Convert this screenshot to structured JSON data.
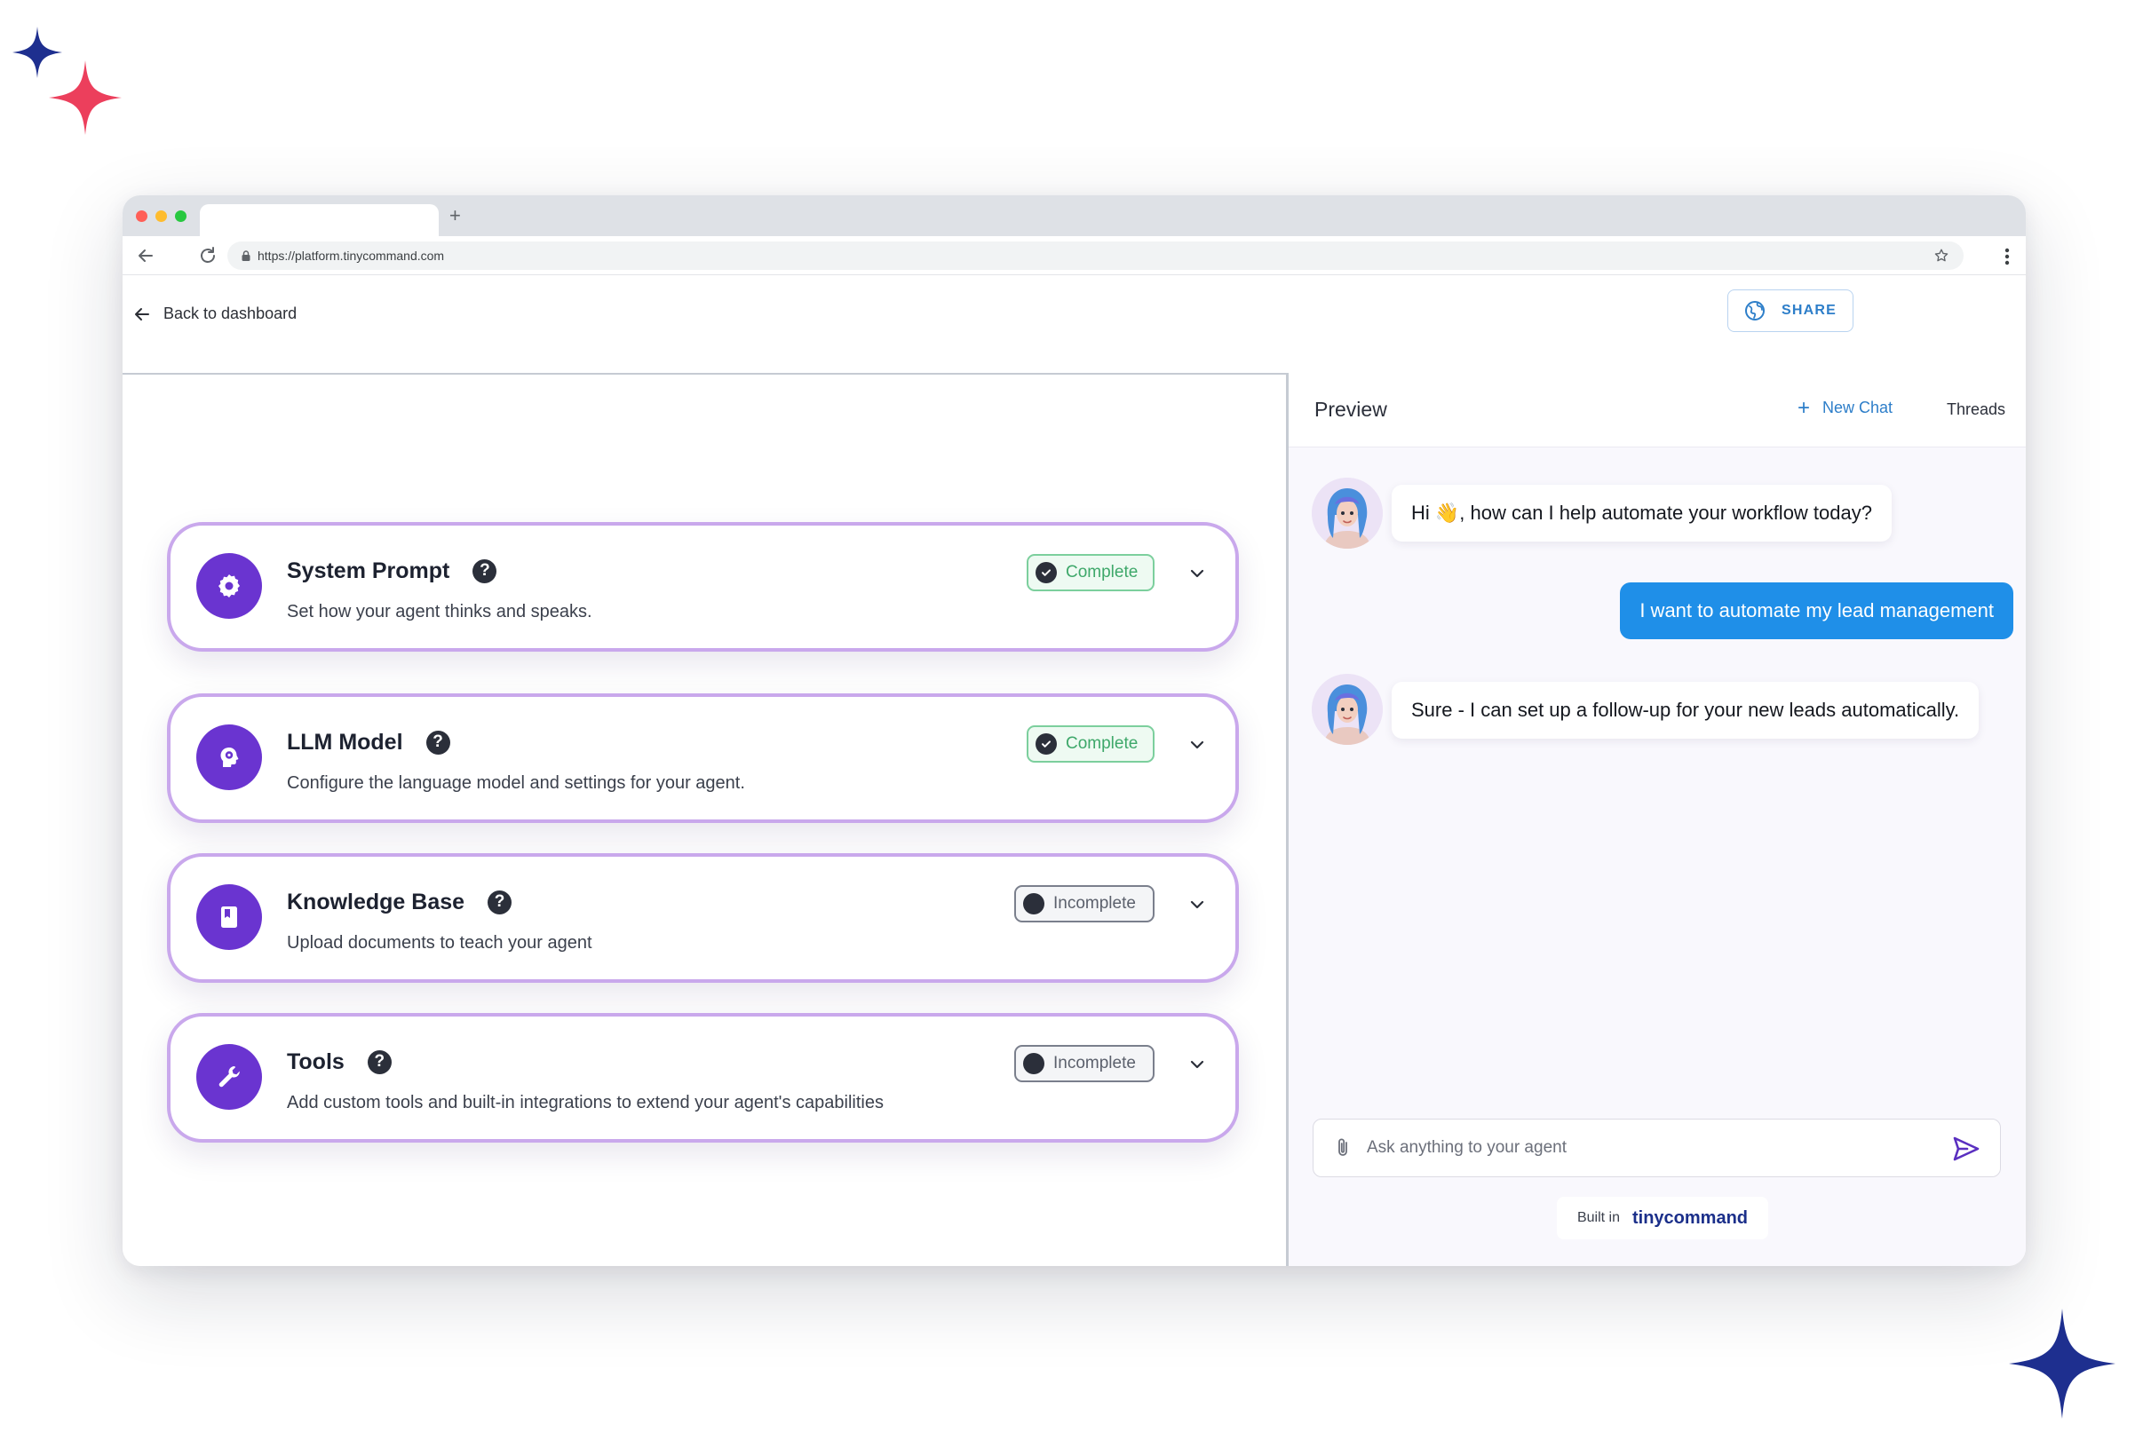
{
  "browser": {
    "url": "https://platform.tinycommand.com",
    "new_tab_glyph": "+"
  },
  "header": {
    "back_label": "Back to dashboard",
    "share_label": "SHARE"
  },
  "cards": [
    {
      "title": "System Prompt",
      "description": "Set how your agent thinks and speaks.",
      "status": "Complete",
      "icon": "gear-icon"
    },
    {
      "title": "LLM Model",
      "description": "Configure the language model and settings for your agent.",
      "status": "Complete",
      "icon": "brain-icon"
    },
    {
      "title": "Knowledge Base",
      "description": "Upload documents to teach your agent",
      "status": "Incomplete",
      "icon": "book-icon"
    },
    {
      "title": "Tools",
      "description": "Add custom tools and built-in integrations to extend your agent's capabilities",
      "status": "Incomplete",
      "icon": "wrench-icon"
    }
  ],
  "help_glyph": "?",
  "preview": {
    "title": "Preview",
    "new_chat_label": "New Chat",
    "new_chat_glyph": "+",
    "threads_label": "Threads",
    "messages": [
      {
        "role": "bot",
        "text": "Hi 👋, how can I help automate your workflow today?"
      },
      {
        "role": "user",
        "text": "I want to automate my lead management"
      },
      {
        "role": "bot",
        "text": "Sure - I can set up a follow-up for your new leads automatically."
      }
    ],
    "input_placeholder": "Ask anything to your agent",
    "built_in_prefix": "Built in",
    "built_in_brand": "tinycommand"
  },
  "colors": {
    "accent_purple": "#6a34d0",
    "card_border": "#c9a8ec",
    "user_bubble": "#1f8fe8",
    "complete_green": "#3ea86a",
    "brand_navy": "#1b2f8a",
    "sparkle_navy": "#1e2f8f",
    "sparkle_pink": "#ec3f5c"
  }
}
